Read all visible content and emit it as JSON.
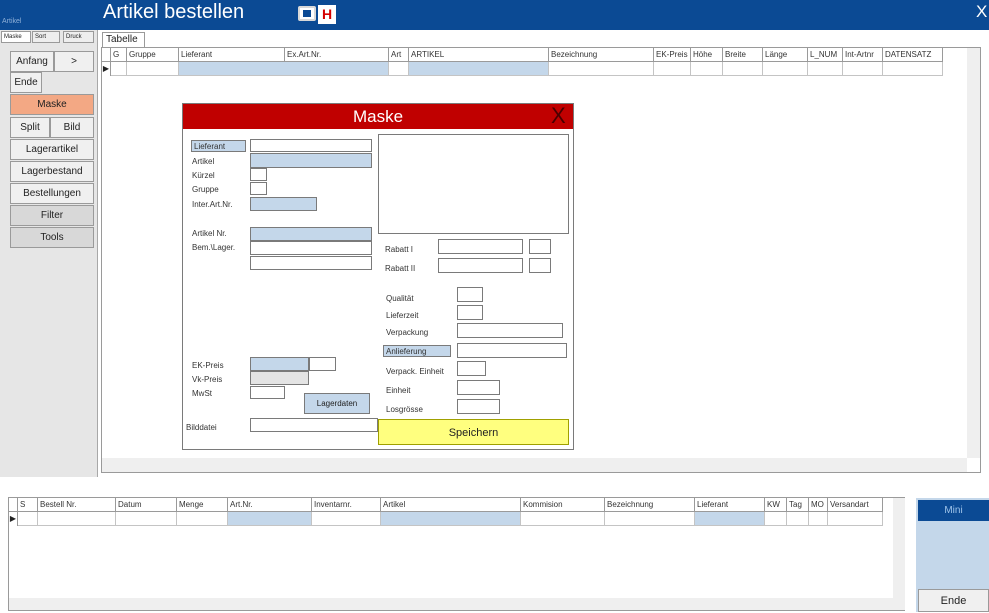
{
  "window": {
    "title": "Artikel bestellen",
    "small_title": "Artikel",
    "close": "X",
    "h_label": "H"
  },
  "left_tabs": [
    "Maske",
    "Sort",
    "Druck"
  ],
  "left_buttons": {
    "anfang": "Anfang",
    "next": ">",
    "ende": "Ende",
    "maske": "Maske",
    "split": "Split",
    "bild": "Bild",
    "lagerartikel": "Lagerartikel",
    "lagerbestand": "Lagerbestand",
    "bestellungen": "Bestellungen",
    "filter": "Filter",
    "tools": "Tools"
  },
  "tabelle": {
    "tab": "Tabelle",
    "columns": [
      "G",
      "Gruppe",
      "Lieferant",
      "Ex.Art.Nr.",
      "Art",
      "ARTIKEL",
      "Bezeichnung",
      "EK-Preis",
      "Höhe",
      "Breite",
      "Länge",
      "L_NUM",
      "Int-Artnr",
      "DATENSATZ"
    ],
    "row_indicator": "▶"
  },
  "mask": {
    "title": "Maske",
    "close": "X",
    "labels": {
      "lieferant": "Lieferant",
      "artikel": "Artikel",
      "kuerzel": "Kürzel",
      "gruppe": "Gruppe",
      "inter_art_nr": "Inter.Art.Nr.",
      "artikel_nr": "Artikel Nr.",
      "bem_lager": "Bem.\\Lager.",
      "ek_preis": "EK-Preis",
      "vk_preis": "Vk-Preis",
      "mwst": "MwSt",
      "bilddatei": "Bilddatei",
      "rabatt1": "Rabatt I",
      "rabatt2": "Rabatt II",
      "qualitaet": "Qualität",
      "lieferzeit": "Lieferzeit",
      "verpackung": "Verpackung",
      "anlieferung": "Anlieferung",
      "verpack_einheit": "Verpack. Einheit",
      "einheit": "Einheit",
      "losgroesse": "Losgrösse"
    },
    "lagerdaten": "Lagerdaten",
    "speichern": "Speichern"
  },
  "bestell": {
    "columns": [
      "S",
      "Bestell Nr.",
      "Datum",
      "Menge",
      "Art.Nr.",
      "Inventarnr.",
      "Artikel",
      "Kommision",
      "Bezeichnung",
      "Lieferant",
      "KW",
      "Tag",
      "MO",
      "Versandart"
    ],
    "row_indicator": "▶"
  },
  "right_panel": {
    "mini": "Mini",
    "ende": "Ende"
  },
  "colors": {
    "title_bar": "#0b4a94",
    "mask_header": "#c00000",
    "field_blue": "#c4d7ea",
    "speichern": "#ffff7f",
    "maske_button": "#f3a884"
  }
}
